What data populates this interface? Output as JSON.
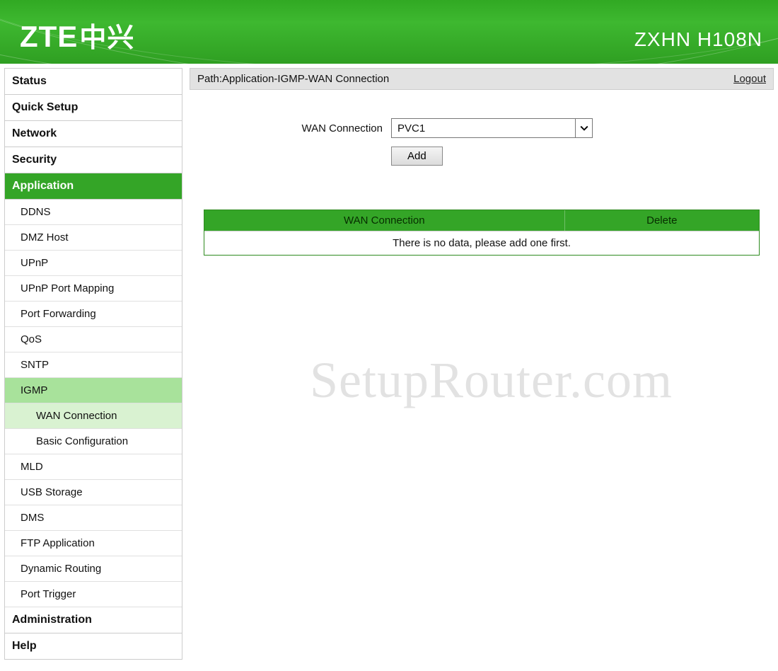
{
  "header": {
    "logo_en": "ZTE",
    "logo_cn": "中兴",
    "model": "ZXHN H108N"
  },
  "path": {
    "label": "Path:Application-IGMP-WAN Connection",
    "logout": "Logout"
  },
  "sidebar": {
    "top": [
      {
        "label": "Status",
        "active": false
      },
      {
        "label": "Quick Setup",
        "active": false
      },
      {
        "label": "Network",
        "active": false
      },
      {
        "label": "Security",
        "active": false
      },
      {
        "label": "Application",
        "active": true
      }
    ],
    "app_sub": [
      {
        "label": "DDNS"
      },
      {
        "label": "DMZ Host"
      },
      {
        "label": "UPnP"
      },
      {
        "label": "UPnP Port Mapping"
      },
      {
        "label": "Port Forwarding"
      },
      {
        "label": "QoS"
      },
      {
        "label": "SNTP"
      },
      {
        "label": "IGMP",
        "active": true,
        "children": [
          {
            "label": "WAN Connection",
            "active": true
          },
          {
            "label": "Basic Configuration"
          }
        ]
      },
      {
        "label": "MLD"
      },
      {
        "label": "USB Storage"
      },
      {
        "label": "DMS"
      },
      {
        "label": "FTP Application"
      },
      {
        "label": "Dynamic Routing"
      },
      {
        "label": "Port Trigger"
      }
    ],
    "bottom": [
      {
        "label": "Administration"
      },
      {
        "label": "Help"
      }
    ]
  },
  "form": {
    "wan_label": "WAN Connection",
    "wan_value": "PVC1",
    "add_label": "Add"
  },
  "table": {
    "col1": "WAN Connection",
    "col2": "Delete",
    "empty": "There is no data, please add one first."
  },
  "watermark": "SetupRouter.com"
}
